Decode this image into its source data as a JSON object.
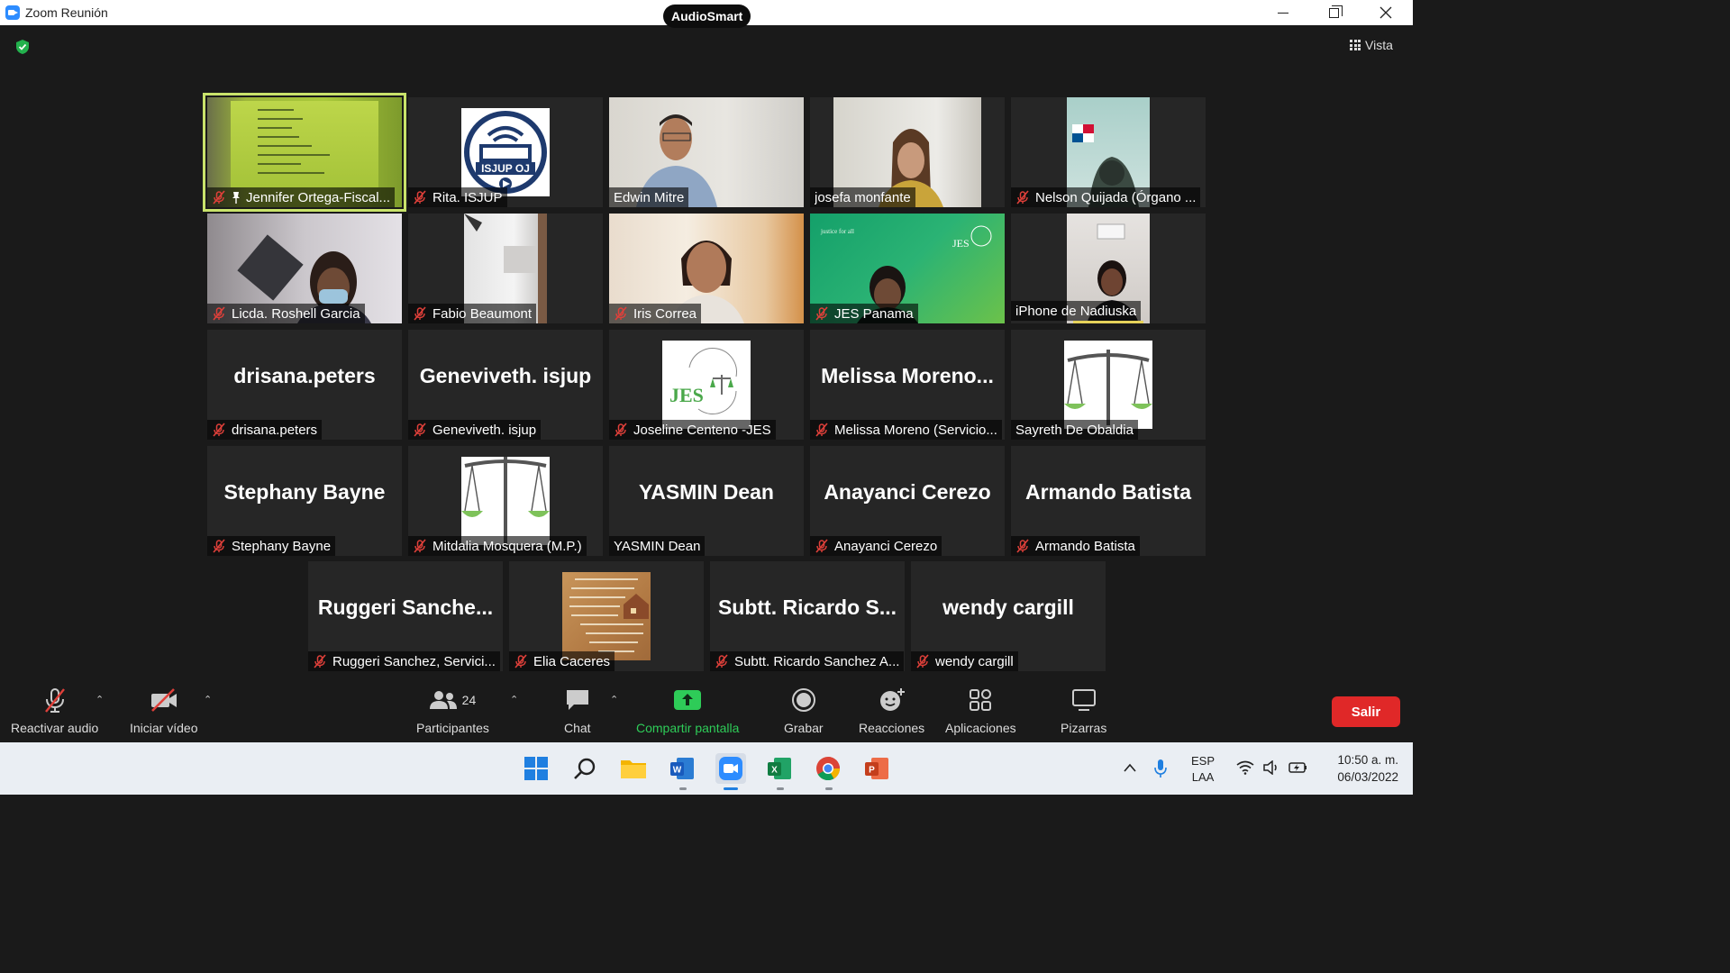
{
  "window": {
    "title": "Zoom Reunión",
    "audio_badge": "AudioSmart",
    "view_label": "Vista"
  },
  "tiles": [
    {
      "name": "Jennifer Ortega-Fiscal...",
      "muted": true,
      "pinned": true,
      "video": true,
      "active": true
    },
    {
      "name": "Rita. ISJUP",
      "muted": true,
      "video": true
    },
    {
      "name": "Edwin Mitre",
      "muted": false,
      "video": true
    },
    {
      "name": "josefa monfante",
      "muted": false,
      "video": true
    },
    {
      "name": "Nelson Quijada (Órgano ...",
      "muted": true,
      "video": true
    },
    {
      "name": "Licda. Roshell Garcia",
      "muted": true,
      "video": true
    },
    {
      "name": "Fabio Beaumont",
      "muted": true,
      "video": true
    },
    {
      "name": "Iris Correa",
      "muted": true,
      "video": true
    },
    {
      "name": "JES Panama",
      "muted": true,
      "video": true
    },
    {
      "name": "iPhone de Nadiuska",
      "muted": false,
      "video": true
    },
    {
      "name": "drisana.peters",
      "display": "drisana.peters",
      "muted": true
    },
    {
      "name": "Geneviveth. isjup",
      "display": "Geneviveth. isjup",
      "muted": true
    },
    {
      "name": "Joseline Centeno -JES",
      "muted": true,
      "video": true
    },
    {
      "name": "Melissa Moreno (Servicio...",
      "display": "Melissa  Moreno...",
      "muted": true
    },
    {
      "name": "Sayreth De Obaldia",
      "muted": false,
      "video": true
    },
    {
      "name": "Stephany Bayne",
      "display": "Stephany Bayne",
      "muted": true
    },
    {
      "name": "Mitdalia Mosquera (M.P.)",
      "muted": true,
      "video": true
    },
    {
      "name": "YASMIN Dean",
      "display": "YASMIN Dean",
      "muted": false
    },
    {
      "name": "Anayanci Cerezo",
      "display": "Anayanci Cerezo",
      "muted": true
    },
    {
      "name": "Armando Batista",
      "display": "Armando Batista",
      "muted": true
    },
    {
      "name": "Ruggeri Sanchez, Servici...",
      "display": "Ruggeri  Sanche...",
      "muted": true
    },
    {
      "name": "Elia Caceres",
      "muted": true,
      "video": true
    },
    {
      "name": "Subtt. Ricardo Sanchez A...",
      "display": "Subtt. Ricardo S...",
      "muted": true
    },
    {
      "name": "wendy cargill",
      "display": "wendy cargill",
      "muted": true
    }
  ],
  "tile_images": {
    "isjup_logo": "ISJUP OJ",
    "jes_logo": "JES",
    "jes_tagline": "justice for all"
  },
  "toolbar": {
    "unmute": "Reactivar audio",
    "start_video": "Iniciar vídeo",
    "participants": "Participantes",
    "participants_count": "24",
    "chat": "Chat",
    "share": "Compartir pantalla",
    "record": "Grabar",
    "reactions": "Reacciones",
    "apps": "Aplicaciones",
    "whiteboards": "Pizarras",
    "leave": "Salir"
  },
  "taskbar": {
    "lang_top": "ESP",
    "lang_bottom": "LAA",
    "time": "10:50 a. m.",
    "date": "06/03/2022"
  },
  "colors": {
    "zoom_blue": "#2D8CFF",
    "share_green": "#2ecc58",
    "leave_red": "#e02828",
    "active_speaker": "#c9e36b",
    "mute_red": "#e0403a"
  }
}
